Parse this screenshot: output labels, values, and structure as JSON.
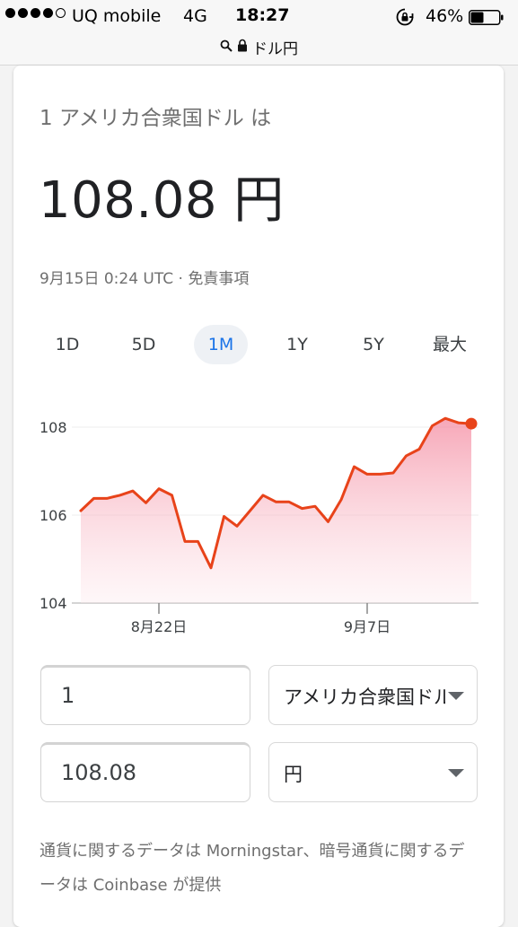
{
  "status_bar": {
    "carrier": "UQ mobile",
    "network": "4G",
    "time": "18:27",
    "battery_percent": "46%",
    "battery_level": 0.46,
    "signal_bars_filled": 4,
    "signal_bars_total": 5
  },
  "browser": {
    "url_text": "ドル円"
  },
  "converter": {
    "label": "1 アメリカ合衆国ドル は",
    "value": "108.08 円",
    "timestamp": "9月15日 0:24 UTC",
    "separator": " · ",
    "disclaimer_link": "免責事項"
  },
  "ranges": [
    {
      "label": "1D"
    },
    {
      "label": "5D"
    },
    {
      "label": "1M"
    },
    {
      "label": "1Y"
    },
    {
      "label": "5Y"
    },
    {
      "label": "最大"
    }
  ],
  "active_range": "1M",
  "chart_data": {
    "type": "area",
    "ylim": [
      104,
      108.3
    ],
    "y_ticks": [
      "108",
      "106",
      "104"
    ],
    "x_tick_labels": [
      "8月22日",
      "9月7日"
    ],
    "line_color": "#e8431a",
    "fill_color": "#f8bcc6",
    "values": [
      106.1,
      106.38,
      106.38,
      106.45,
      106.55,
      106.28,
      106.6,
      106.45,
      105.4,
      105.4,
      104.8,
      105.97,
      105.75,
      106.1,
      106.45,
      106.3,
      106.3,
      106.15,
      106.2,
      105.85,
      106.35,
      107.1,
      106.93,
      106.93,
      106.96,
      107.35,
      107.5,
      108.03,
      108.2,
      108.1,
      108.08
    ],
    "x_tick_indices": [
      6,
      22
    ],
    "last_point_marker": true
  },
  "inputs": {
    "from_amount": "1",
    "to_amount": "108.08",
    "from_currency": "アメリカ合衆国ドル",
    "to_currency": "円"
  },
  "footnote": "通貨に関するデータは Morningstar、暗号通貨に関するデータは Coinbase が提供"
}
